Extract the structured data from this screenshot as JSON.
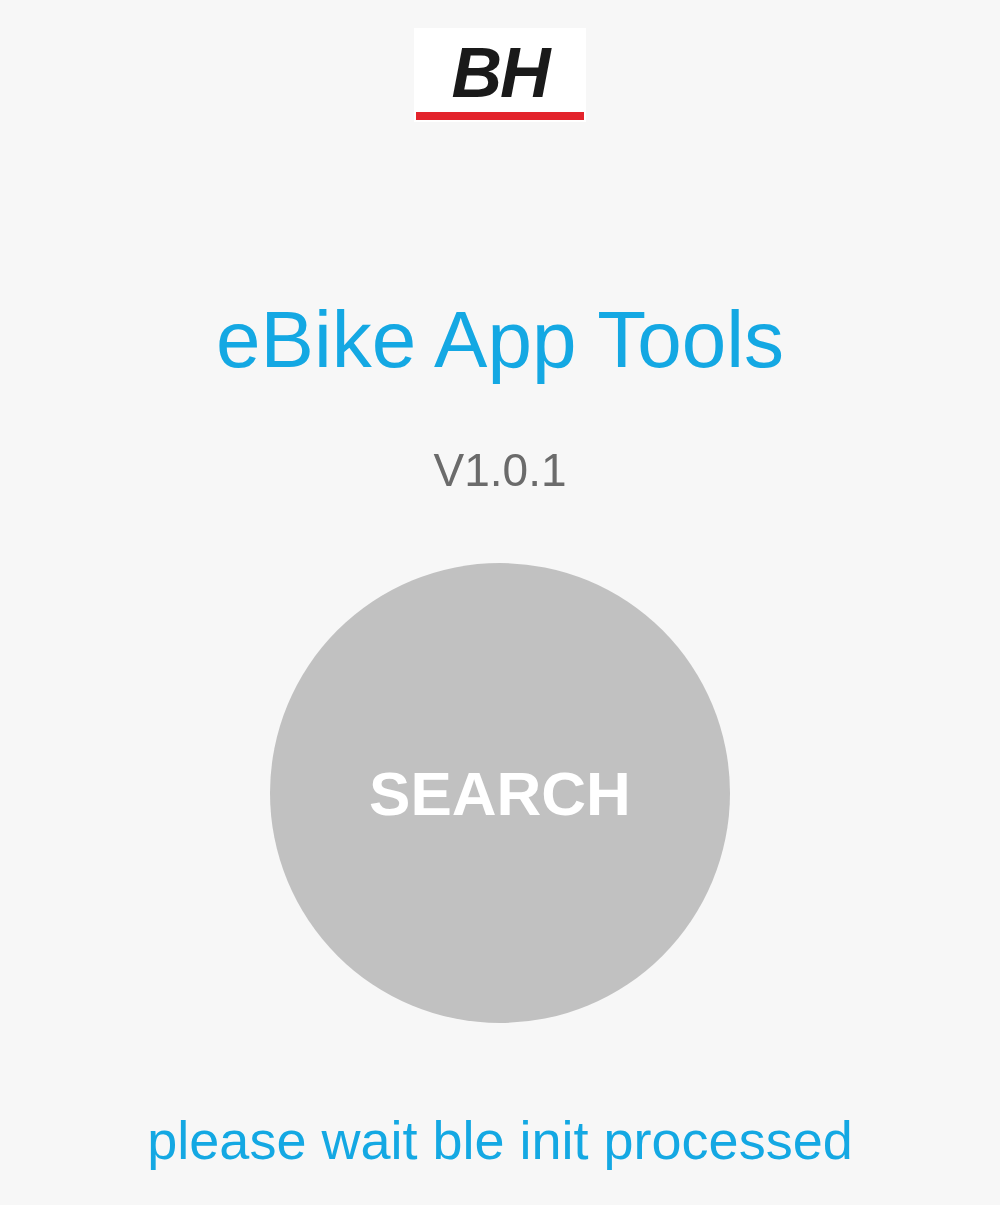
{
  "logo": {
    "text": "BH"
  },
  "title": "eBike App Tools",
  "version": "V1.0.1",
  "search_button": {
    "label": "SEARCH",
    "disabled": true
  },
  "status_message": "please wait ble init processed"
}
